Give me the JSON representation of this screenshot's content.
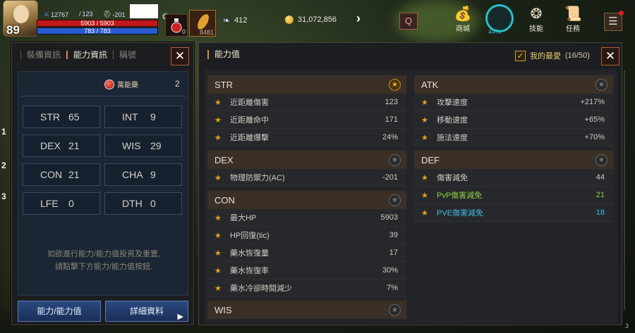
{
  "hud": {
    "level": "89",
    "stat_a": "12767",
    "stat_b": "123",
    "stat_c": "-201",
    "hp": "5903 / 5903",
    "mp": "783 / 783",
    "potion_count": "0",
    "feather_count": "8481",
    "wings": "412",
    "gold": "31,072,856",
    "q_label": "Q",
    "shop_label": "商城",
    "ring_pct": "44%",
    "skill_label": "技能",
    "quest_label": "任務",
    "side_numbers": [
      "1",
      "2",
      "3"
    ],
    "corner_num": "3"
  },
  "left": {
    "tabs": [
      "裝備資訊",
      "能力資訊",
      "稱號"
    ],
    "active_tab": 1,
    "elixir_label": "萬能藥",
    "elixir_count": "2",
    "stats": [
      {
        "k": "STR",
        "v": "65"
      },
      {
        "k": "INT",
        "v": "9"
      },
      {
        "k": "DEX",
        "v": "21"
      },
      {
        "k": "WIS",
        "v": "29"
      },
      {
        "k": "CON",
        "v": "21"
      },
      {
        "k": "CHA",
        "v": "9"
      },
      {
        "k": "LFE",
        "v": "0"
      },
      {
        "k": "DTH",
        "v": "0"
      }
    ],
    "hint_line1": "如欲進行能力/能力值投資及重置,",
    "hint_line2": "請點擊下方能力/能力值按鈕.",
    "btn_ability": "能力/能力值",
    "btn_detail": "詳細資料"
  },
  "right": {
    "title": "能力值",
    "fav_label": "我的最愛",
    "fav_count": "(16/50)",
    "str": {
      "head": "STR",
      "rows": [
        {
          "name": "近距離傷害",
          "value": "123"
        },
        {
          "name": "近距離命中",
          "value": "171"
        },
        {
          "name": "近距離爆擊",
          "value": "24%"
        }
      ]
    },
    "dex": {
      "head": "DEX",
      "rows": [
        {
          "name": "物理防禦力(AC)",
          "value": "-201"
        }
      ]
    },
    "con": {
      "head": "CON",
      "rows": [
        {
          "name": "最大HP",
          "value": "5903"
        },
        {
          "name": "HP回復(tic)",
          "value": "39"
        },
        {
          "name": "藥水恢復量",
          "value": "17"
        },
        {
          "name": "藥水恢復率",
          "value": "30%"
        },
        {
          "name": "藥水冷卻時間減少",
          "value": "7%"
        }
      ]
    },
    "wis": {
      "head": "WIS"
    },
    "atk": {
      "head": "ATK",
      "rows": [
        {
          "name": "攻擊速度",
          "value": "+217%"
        },
        {
          "name": "移動速度",
          "value": "+65%"
        },
        {
          "name": "施法速度",
          "value": "+70%"
        }
      ]
    },
    "def": {
      "head": "DEF",
      "rows": [
        {
          "name": "傷害減免",
          "value": "44"
        },
        {
          "name": "PvP傷害減免",
          "value": "21"
        },
        {
          "name": "PVE傷害減免",
          "value": "18"
        }
      ]
    }
  }
}
